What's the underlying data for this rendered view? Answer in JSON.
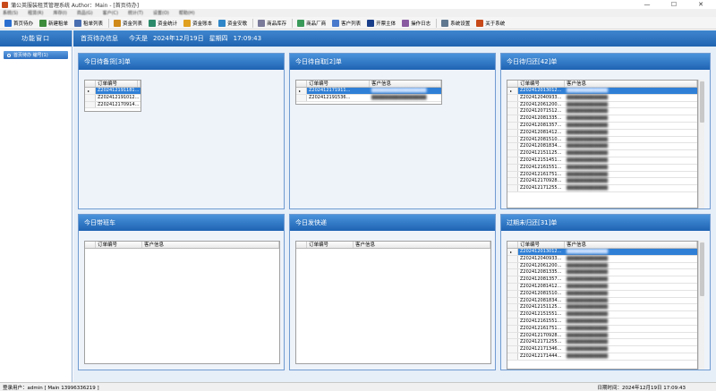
{
  "window": {
    "title": "蒲公英服装租赁管理系统 Author：Main - [首页待办]",
    "minimize": "—",
    "maximize": "☐",
    "close": "✕"
  },
  "menu": [
    "系统(S)",
    "租赁(R)",
    "库存(I)",
    "商品(G)",
    "客户(C)",
    "统计(T)",
    "设置(O)",
    "帮助(H)"
  ],
  "toolbar": [
    {
      "label": "首页待办",
      "color": "#2a6fd0"
    },
    {
      "label": "新建租单",
      "color": "#3c8c3c"
    },
    {
      "label": "租单列表",
      "color": "#4a6fb0"
    },
    {
      "label": "资金列表",
      "color": "#d08a1a"
    },
    {
      "label": "资金统计",
      "color": "#2b8a6a"
    },
    {
      "label": "资金账本",
      "color": "#e0a020"
    },
    {
      "label": "资金安歌",
      "color": "#2f86c8"
    },
    {
      "label": "商品库存",
      "color": "#7a7a9a"
    },
    {
      "label": "商品厂商",
      "color": "#3a9a5a"
    },
    {
      "label": "客户列表",
      "color": "#4a7acc"
    },
    {
      "label": "开票主体",
      "color": "#1a3f8a"
    },
    {
      "label": "操作日志",
      "color": "#8a5aa0"
    },
    {
      "label": "系统设置",
      "color": "#607890"
    },
    {
      "label": "关于系统",
      "color": "#c84a1a"
    }
  ],
  "sidebar": {
    "header": "功能窗口",
    "item": "首页待办 编号(1)"
  },
  "main_header": {
    "title": "首页待办信息",
    "date_prefix": "今天是",
    "date": "2024年12月19日",
    "weekday": "星期四",
    "time": "17:09:43"
  },
  "columns": {
    "order": "订单编号",
    "customer": "客户信息"
  },
  "panels": {
    "p1": {
      "title": "今日待备货[3]单",
      "rows": [
        {
          "order": "Z202412191181...",
          "customer": "████████████████"
        },
        {
          "order": "Z202412191012...",
          "customer": "████████████████"
        },
        {
          "order": "Z202412170914...",
          "customer": "████████████████"
        }
      ]
    },
    "p2": {
      "title": "今日待自取[2]单",
      "rows": [
        {
          "order": "Z202412171911...",
          "customer": "████████████████"
        },
        {
          "order": "Z202412191536...",
          "customer": "████████████████"
        }
      ]
    },
    "p3": {
      "title": "今日待归还[42]单",
      "rows": [
        {
          "order": "Z202412013012...",
          "customer": "████████████"
        },
        {
          "order": "Z202412040933...",
          "customer": "████████████"
        },
        {
          "order": "Z202412061200...",
          "customer": "████████████"
        },
        {
          "order": "Z202412071512...",
          "customer": "████████████"
        },
        {
          "order": "Z202412081335...",
          "customer": "████████████"
        },
        {
          "order": "Z202412081357...",
          "customer": "████████████"
        },
        {
          "order": "Z202412081412...",
          "customer": "████████████"
        },
        {
          "order": "Z202412081510...",
          "customer": "████████████"
        },
        {
          "order": "Z202412081834...",
          "customer": "████████████"
        },
        {
          "order": "Z202412151125...",
          "customer": "████████████"
        },
        {
          "order": "Z202412151451...",
          "customer": "████████████"
        },
        {
          "order": "Z202412161551...",
          "customer": "████████████"
        },
        {
          "order": "Z202412161751...",
          "customer": "████████████"
        },
        {
          "order": "Z202412170928...",
          "customer": "████████████"
        },
        {
          "order": "Z202412171255...",
          "customer": "████████████"
        }
      ]
    },
    "p4": {
      "title": "今日带班车",
      "rows": []
    },
    "p5": {
      "title": "今日发快递",
      "rows": []
    },
    "p6": {
      "title": "过期未归还[31]单",
      "rows": [
        {
          "order": "Z202412013012...",
          "customer": "████████████"
        },
        {
          "order": "Z202412040933...",
          "customer": "████████████"
        },
        {
          "order": "Z202412061200...",
          "customer": "████████████"
        },
        {
          "order": "Z202412081335...",
          "customer": "████████████"
        },
        {
          "order": "Z202412081357...",
          "customer": "████████████"
        },
        {
          "order": "Z202412081412...",
          "customer": "████████████"
        },
        {
          "order": "Z202412081510...",
          "customer": "████████████"
        },
        {
          "order": "Z202412081834...",
          "customer": "████████████"
        },
        {
          "order": "Z202412151125...",
          "customer": "████████████"
        },
        {
          "order": "Z202412151551...",
          "customer": "████████████"
        },
        {
          "order": "Z202412161551...",
          "customer": "████████████"
        },
        {
          "order": "Z202412161751...",
          "customer": "████████████"
        },
        {
          "order": "Z202412170928...",
          "customer": "████████████"
        },
        {
          "order": "Z202412171255...",
          "customer": "████████████"
        },
        {
          "order": "Z202412171346...",
          "customer": "████████████"
        },
        {
          "order": "Z202412171444...",
          "customer": "████████████"
        }
      ]
    }
  },
  "status": {
    "login_label": "登录用户：admin [ Main 13996336219 ]",
    "datetime_label": "日期时间：2024年12月19日 17:09:43"
  },
  "colors": {
    "accent": "#1f63b0",
    "selected_row": "#2f7fd6"
  }
}
